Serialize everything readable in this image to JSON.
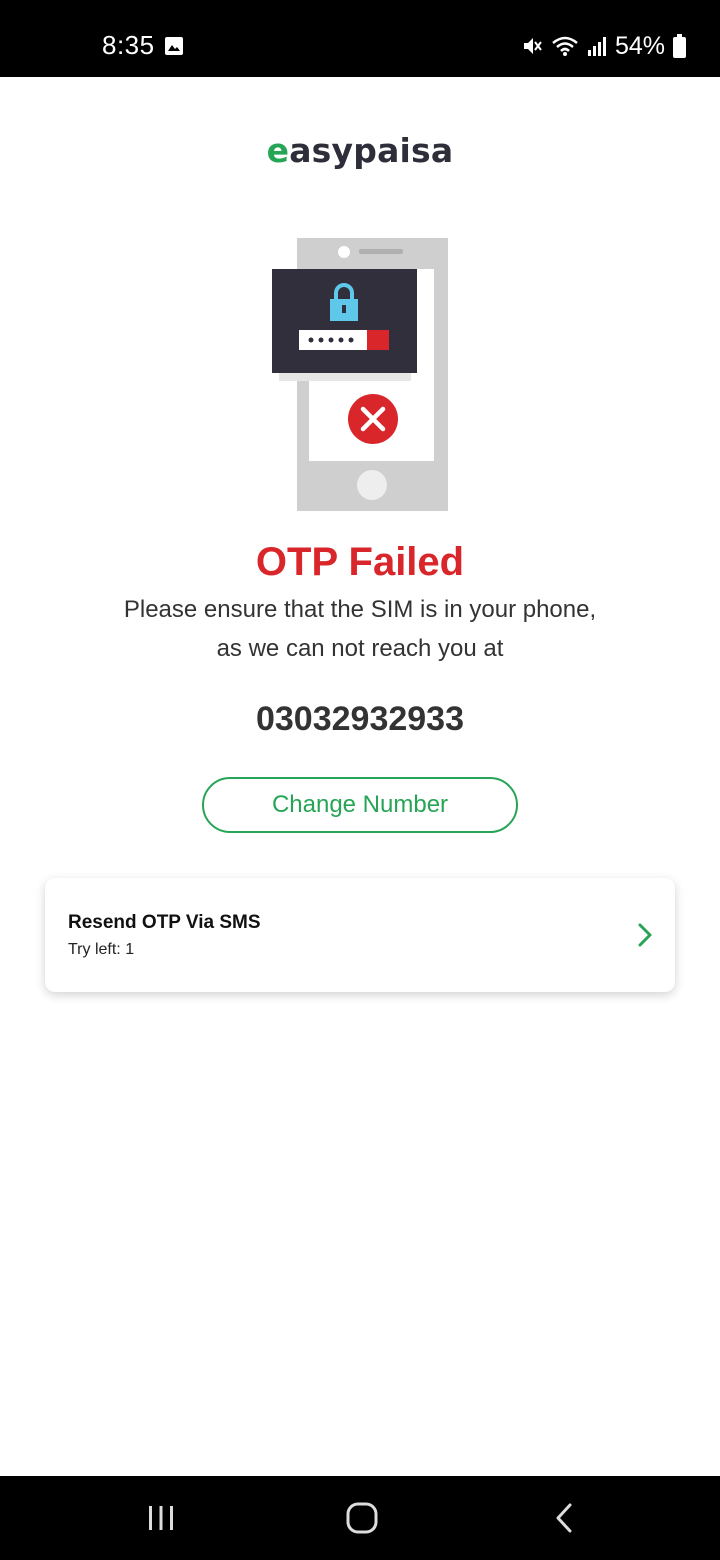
{
  "status_bar": {
    "time": "8:35",
    "battery": "54%",
    "icons": [
      "gallery-icon",
      "mute-icon",
      "wifi-icon",
      "signal-icon",
      "battery-icon"
    ]
  },
  "brand": {
    "logo_first": "e",
    "logo_rest": "asypaisa",
    "accent_color": "#27a556"
  },
  "error": {
    "title": "OTP Failed",
    "title_color": "#d9262a",
    "description_line1": "Please ensure that the SIM is in your phone,",
    "description_line2": "as we can not reach you at",
    "phone_number": "03032932933"
  },
  "actions": {
    "change_number_label": "Change Number"
  },
  "resend_card": {
    "title": "Resend OTP Via SMS",
    "subtitle": "Try left: 1"
  },
  "nav_bar": {
    "icons": [
      "recent-apps-icon",
      "home-icon",
      "back-icon"
    ]
  }
}
